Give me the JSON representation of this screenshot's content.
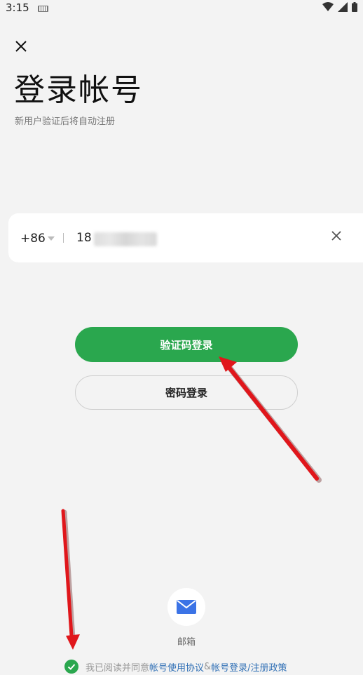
{
  "status_bar": {
    "time": "3:15"
  },
  "login": {
    "title": "登录帐号",
    "subtitle": "新用户验证后将自动注册",
    "country_code": "+86",
    "phone_value": "18",
    "sms_login_label": "验证码登录",
    "password_login_label": "密码登录",
    "email_label": "邮箱"
  },
  "agreement": {
    "prefix": "我已阅读并同意 ",
    "user_agreement": "帐号使用协议",
    "connector": " & ",
    "privacy_policy": "帐号登录/注册政策"
  },
  "colors": {
    "primary_green": "#2aa74e",
    "link_blue": "#2f6fb5",
    "background": "#f3f3f3",
    "annotation_red": "#e0161b"
  }
}
